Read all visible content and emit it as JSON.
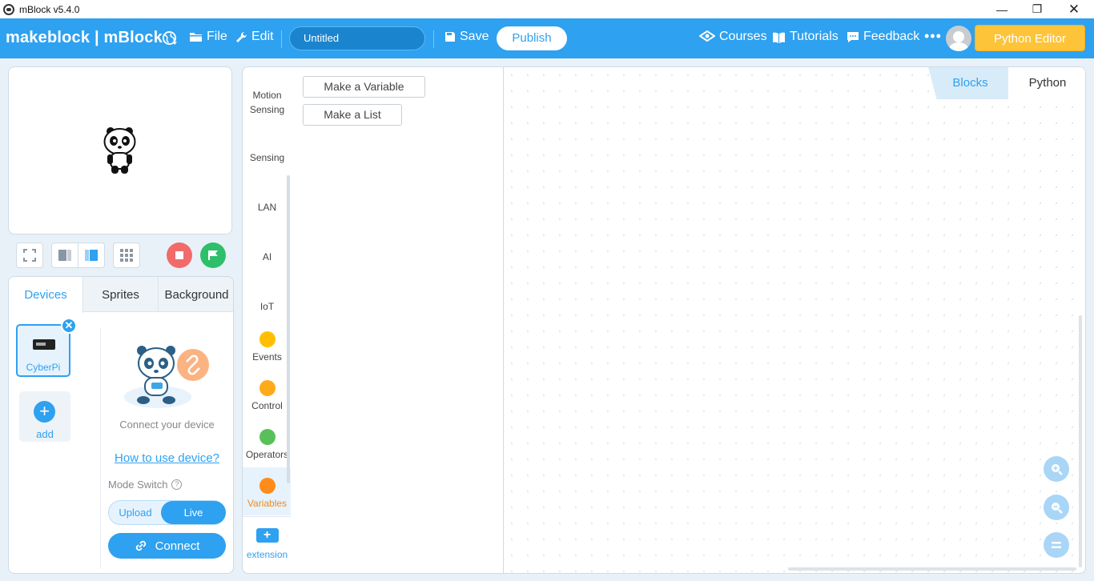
{
  "window": {
    "title": "mBlock v5.4.0",
    "minimize": "—",
    "maximize": "❐",
    "close": "✕"
  },
  "topbar": {
    "logo": "makeblock | mBlock",
    "file": "File",
    "edit": "Edit",
    "project_name": "Untitled",
    "save": "Save",
    "publish": "Publish",
    "courses": "Courses",
    "tutorials": "Tutorials",
    "feedback": "Feedback",
    "more": "•••",
    "python_editor": "Python Editor",
    "accent_color": "#2ea1f0",
    "python_editor_color": "#fdc43a"
  },
  "devices_panel": {
    "tabs": [
      "Devices",
      "Sprites",
      "Background"
    ],
    "active_tab": "Devices",
    "device_name": "CyberPi",
    "remove": "✕",
    "add_label": "add",
    "add_plus": "+",
    "connect_text": "Connect your device",
    "howto_link": "How to use device?",
    "mode_switch_label": "Mode Switch",
    "help": "?",
    "mode_upload": "Upload",
    "mode_live": "Live",
    "connect_button": "Connect"
  },
  "categories": {
    "items": [
      {
        "label": "Motion Sensing",
        "icon": "none"
      },
      {
        "label": "Sensing",
        "icon": "none"
      },
      {
        "label": "LAN",
        "icon": "none"
      },
      {
        "label": "AI",
        "icon": "none"
      },
      {
        "label": "IoT",
        "icon": "none"
      },
      {
        "label": "Events",
        "color": "#ffbf00"
      },
      {
        "label": "Control",
        "color": "#ffab19"
      },
      {
        "label": "Operators",
        "color": "#59c059"
      },
      {
        "label": "Variables",
        "color": "#ff8c1a"
      }
    ],
    "active": "Variables",
    "extension_label": "extension",
    "extension_plus": "+"
  },
  "palette": {
    "make_variable": "Make a Variable",
    "make_list": "Make a List"
  },
  "workspace": {
    "tab_blocks": "Blocks",
    "tab_python": "Python",
    "active_tab": "Blocks"
  }
}
